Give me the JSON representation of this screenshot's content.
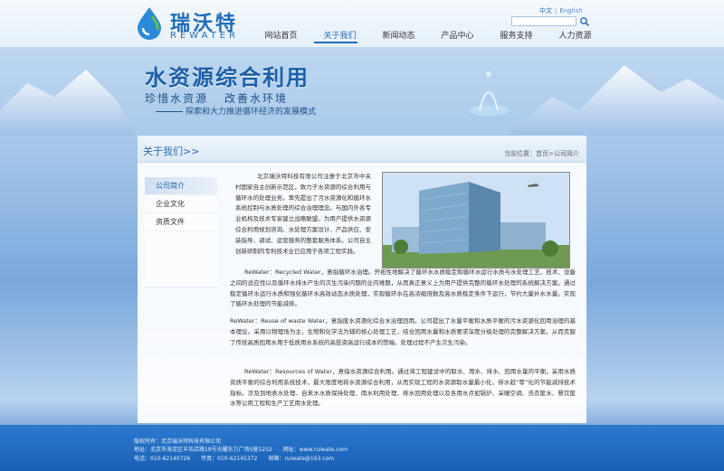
{
  "header": {
    "logo_cn": "瑞沃特",
    "logo_en": "REWATER",
    "lang_cn": "中文",
    "lang_en": "English",
    "search_placeholder": "",
    "nav": [
      "网站首页",
      "关于我们",
      "新闻动态",
      "产品中心",
      "服务支持",
      "人力资源"
    ],
    "active_nav": "关于我们"
  },
  "banner": {
    "title": "水资源综合利用",
    "sub1a": "珍惜水资源",
    "sub1b": "改善水环境",
    "sub2": "探索和大力推进循环经济的发展模式"
  },
  "panel": {
    "title": "关于我们>>",
    "breadcrumb": "当前位置：首页>公司简介",
    "sidenav": [
      "公司简介",
      "企业文化",
      "资质文件"
    ],
    "p1": "北京瑞沃特科技有限公司注册于北京市中关村国家自主创新示范区，致力于水资源的综合利用与循环水的处理业务。率先提出了污水资源化和循环水系统控制与水质处理的综合治理理念。与国内外各专业机构及技术专家建立战略联盟，为用户提供水资源综合利用规划咨询、水处理方案设计、产品供应、安装指导、调试、运营服务的整套服务体系。公司自主创新研制的专利技术业已应用于各项工程实践。",
    "p2": "ReWater：Recycled Water，意指循环水治理。开拓性地解决了循环水水质稳定和循环水运行水质与水处理工艺、技术、设备之间的适应性以及循环水排水产生的次生污染问题的业内难题，从而真正意义上为用户提供完整的循环水处理的系统解决方案。通过稳定循环水运行水质和强化循环水高效动态水质处理，实现循环水在高浓缩倍数及高水质稳定条件下运行，节约大量补水水量。实现了循环水处理的节能减排。",
    "p3": "ReWater：Reuse of waste Water，意指废水资源化综合水治理回用。公司提出了水量平衡和水质平衡的污水资源化回用治理的基本理论。采用以物理场为主，生物和化学法为辅的核心处理工艺，结合回用水量和水质要求深度分级处理的完整解决方案，从而克服了传统高质回用水用于低质用水系统的高投资高运行成本的弊端。处理过程不产生次生污染。",
    "p4": "ReWater：Resources of Water，意指水资源综合利用。通过将工程建设中的取水、用水、排水、回用水量的平衡，采用水质资质平衡的综合利用系统技术，最大限度地将水资源综合利用，从而实现工程的水资源取水量最小化，排水趋“零”化的节能减排技术指标。涉及到地表水处理、自来水水质保持处理、雨水利用处理、排水回用处理以及各用水点如锅炉、采暖空调、洗衣废水、餐饮废水等公用工程和生产工艺用水处理。"
  },
  "footer": {
    "copyright": "版权所有：北京瑞沃特科技有限公司",
    "address": "地址：北京市海淀区羊坊店路18号光耀东方广场S座1252",
    "website": "网址：www.ruiwate.com",
    "tel": "电话：010-62140726",
    "fax": "传真：010-62145372",
    "email": "邮箱：ruiwate@163.com"
  },
  "colors": {
    "brand": "#1e6cb8",
    "footer": "#1a5fb5"
  }
}
